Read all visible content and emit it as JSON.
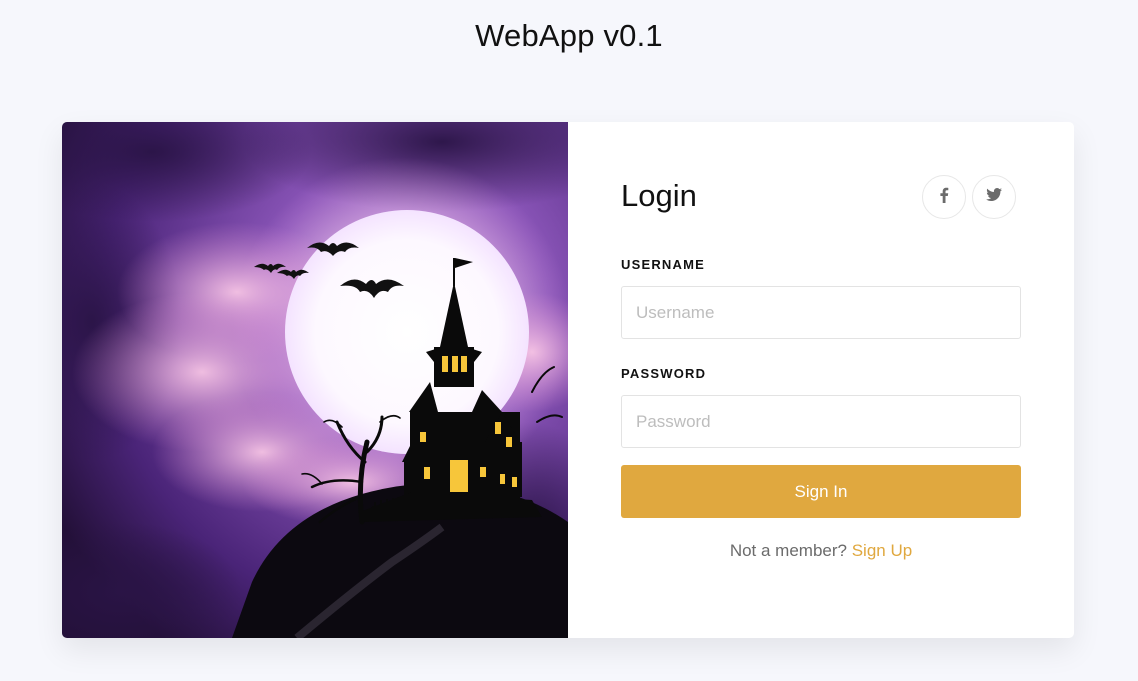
{
  "header": {
    "title": "WebApp v0.1"
  },
  "login": {
    "heading": "Login",
    "username_label": "USERNAME",
    "username_placeholder": "Username",
    "username_value": "",
    "password_label": "PASSWORD",
    "password_placeholder": "Password",
    "password_value": "",
    "submit_label": "Sign In",
    "footer_text": "Not a member? ",
    "signup_link": "Sign Up"
  },
  "social": [
    {
      "icon": "facebook-icon"
    },
    {
      "icon": "twitter-icon"
    }
  ],
  "colors": {
    "background": "#f6f7fc",
    "accent": "#e0a83f",
    "card": "#ffffff"
  }
}
